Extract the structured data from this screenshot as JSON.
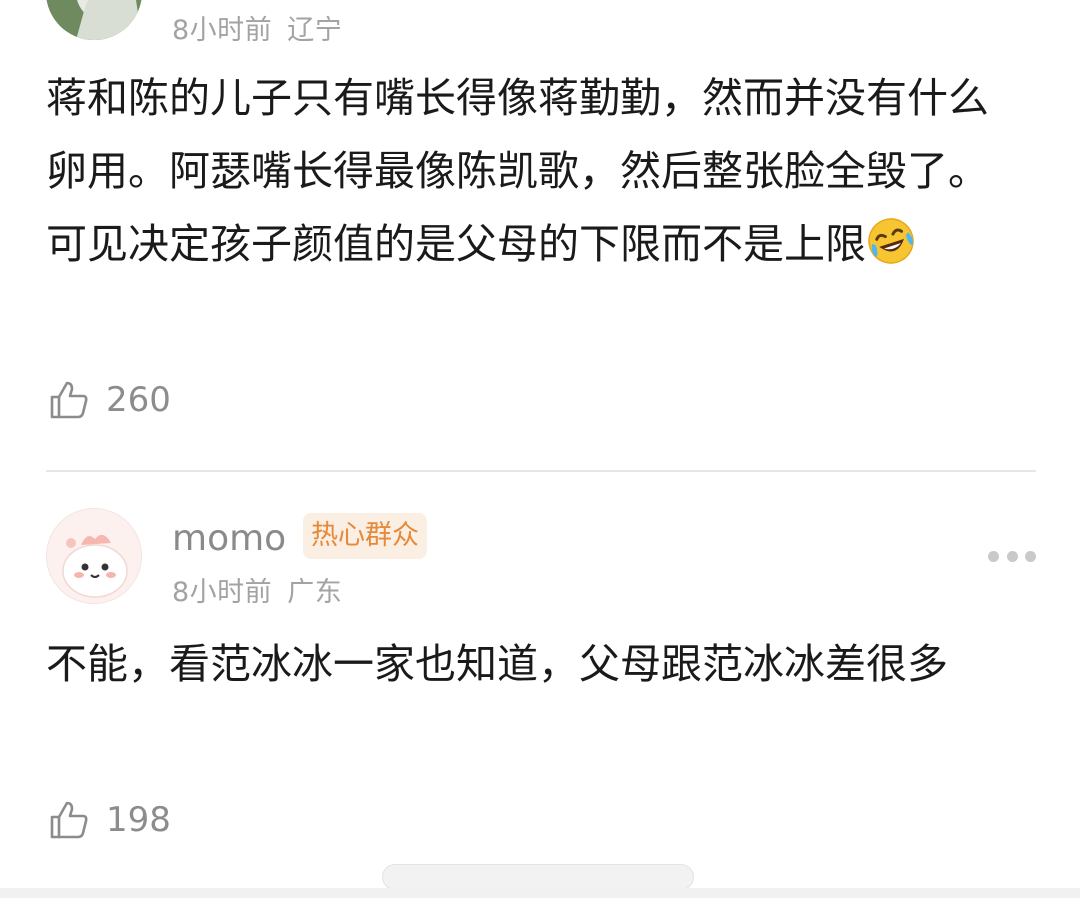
{
  "comments": [
    {
      "time": "8小时前",
      "location": "辽宁",
      "text": "蒋和陈的儿子只有嘴长得像蒋勤勤，然而并没有什么卵用。阿瑟嘴长得最像陈凯歌，然后整张脸全毁了。可见决定孩子颜值的是父母的下限而不是上限",
      "emoji": "rolling-on-floor-laughing",
      "likes": "260"
    },
    {
      "username": "momo",
      "badge": "热心群众",
      "time": "8小时前",
      "location": "广东",
      "text": "不能，看范冰冰一家也知道，父母跟范冰冰差很多",
      "likes": "198"
    }
  ],
  "colors": {
    "meta_text": "#a3a3a3",
    "badge_bg": "#fbefe3",
    "badge_text": "#e58a3a",
    "divider": "#e6e6e6"
  },
  "icons": [
    "thumbs-up-icon",
    "more-icon",
    "laughing-emoji-icon"
  ]
}
